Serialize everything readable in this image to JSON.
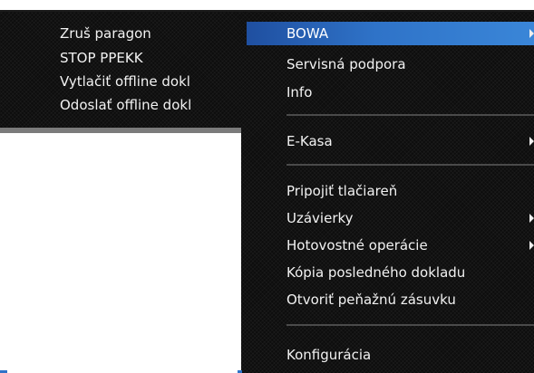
{
  "left_menu": {
    "items": [
      {
        "label": "Zruš paragon"
      },
      {
        "label": "STOP PPEKK"
      },
      {
        "label": "Vytlačiť offline dokl"
      },
      {
        "label": "Odoslať offline dokl"
      }
    ]
  },
  "right_menu": {
    "items": [
      {
        "label": "BOWA",
        "highlighted": true,
        "submenu_icon": "chevron-right-icon"
      },
      {
        "label": "Servisná podpora"
      },
      {
        "label": "Info"
      },
      {
        "label": "E-Kasa",
        "submenu_icon": "chevron-right-icon"
      },
      {
        "label": "Pripojiť tlačiareň"
      },
      {
        "label": "Uzávierky",
        "submenu_icon": "chevron-right-icon"
      },
      {
        "label": "Hotovostné operácie",
        "submenu_icon": "chevron-right-icon"
      },
      {
        "label": "Kópia posledného dokladu"
      },
      {
        "label": "Otvoriť peňažnú zásuvku"
      },
      {
        "label": "Konfigurácia"
      }
    ]
  },
  "colors": {
    "menu_background": "#0d0d0d",
    "menu_text": "#f2f2f2",
    "highlight": "#2f73c8",
    "menu_border": "#7b7b7b"
  }
}
